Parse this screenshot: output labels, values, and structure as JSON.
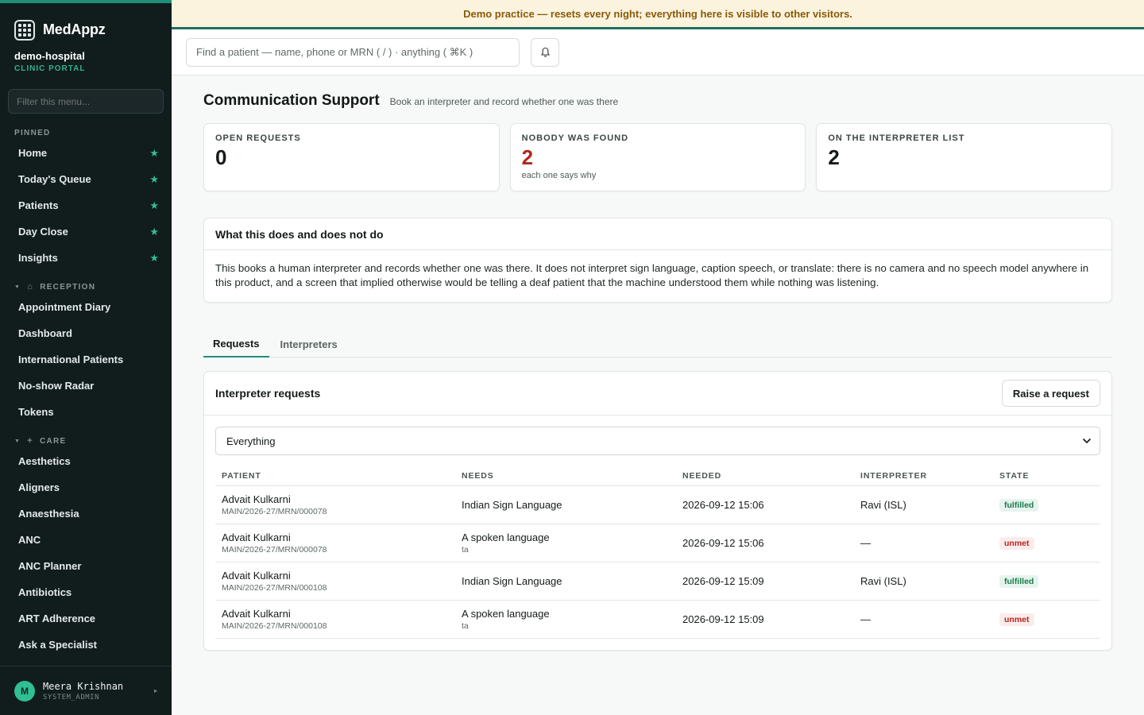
{
  "brand": {
    "name": "MedAppz"
  },
  "org": {
    "name": "demo-hospital",
    "subtitle": "CLINIC PORTAL"
  },
  "sidebar": {
    "filter_placeholder": "Filter this menu...",
    "pinned_label": "PINNED",
    "pinned": [
      {
        "label": "Home"
      },
      {
        "label": "Today's Queue"
      },
      {
        "label": "Patients"
      },
      {
        "label": "Day Close"
      },
      {
        "label": "Insights"
      }
    ],
    "reception_label": "RECEPTION",
    "reception": [
      {
        "label": "Appointment Diary"
      },
      {
        "label": "Dashboard"
      },
      {
        "label": "International Patients"
      },
      {
        "label": "No-show Radar"
      },
      {
        "label": "Tokens"
      }
    ],
    "care_label": "CARE",
    "care": [
      {
        "label": "Aesthetics"
      },
      {
        "label": "Aligners"
      },
      {
        "label": "Anaesthesia"
      },
      {
        "label": "ANC"
      },
      {
        "label": "ANC Planner"
      },
      {
        "label": "Antibiotics"
      },
      {
        "label": "ART Adherence"
      },
      {
        "label": "Ask a Specialist"
      }
    ],
    "user": {
      "initial": "M",
      "name": "Meera Krishnan",
      "role": "SYSTEM_ADMIN"
    }
  },
  "banner": {
    "text": "Demo practice — resets every night; everything here is visible to other visitors."
  },
  "topbar": {
    "search_placeholder": "Find a patient — name, phone or MRN ( / ) · anything ( ⌘K )"
  },
  "page": {
    "title": "Communication Support",
    "subtitle": "Book an interpreter and record whether one was there"
  },
  "stats": [
    {
      "label": "OPEN REQUESTS",
      "value": "0",
      "note": ""
    },
    {
      "label": "NOBODY WAS FOUND",
      "value": "2",
      "note": "each one says why"
    },
    {
      "label": "ON THE INTERPRETER LIST",
      "value": "2",
      "note": ""
    }
  ],
  "info": {
    "title": "What this does and does not do",
    "body": "This books a human interpreter and records whether one was there. It does not interpret sign language, caption speech, or translate: there is no camera and no speech model anywhere in this product, and a screen that implied otherwise would be telling a deaf patient that the machine understood them while nothing was listening."
  },
  "tabs": [
    {
      "label": "Requests"
    },
    {
      "label": "Interpreters"
    }
  ],
  "requests": {
    "title": "Interpreter requests",
    "raise_label": "Raise a request",
    "filter_value": "Everything",
    "columns": [
      "PATIENT",
      "NEEDS",
      "NEEDED",
      "INTERPRETER",
      "STATE"
    ],
    "rows": [
      {
        "patient": "Advait Kulkarni",
        "mrn": "MAIN/2026-27/MRN/000078",
        "needs": "Indian Sign Language",
        "needs_sub": "",
        "needed": "2026-09-12 15:06",
        "interpreter": "Ravi (ISL)",
        "state": "fulfilled"
      },
      {
        "patient": "Advait Kulkarni",
        "mrn": "MAIN/2026-27/MRN/000078",
        "needs": "A spoken language",
        "needs_sub": "ta",
        "needed": "2026-09-12 15:06",
        "interpreter": "—",
        "state": "unmet"
      },
      {
        "patient": "Advait Kulkarni",
        "mrn": "MAIN/2026-27/MRN/000108",
        "needs": "Indian Sign Language",
        "needs_sub": "",
        "needed": "2026-09-12 15:09",
        "interpreter": "Ravi (ISL)",
        "state": "fulfilled"
      },
      {
        "patient": "Advait Kulkarni",
        "mrn": "MAIN/2026-27/MRN/000108",
        "needs": "A spoken language",
        "needs_sub": "ta",
        "needed": "2026-09-12 15:09",
        "interpreter": "—",
        "state": "unmet"
      }
    ]
  },
  "colors": {
    "accent": "#1f8f79",
    "sidebar_bg": "#111c1d",
    "danger": "#b3261e",
    "success": "#1b7a4a",
    "banner_bg": "#fbf3de"
  }
}
